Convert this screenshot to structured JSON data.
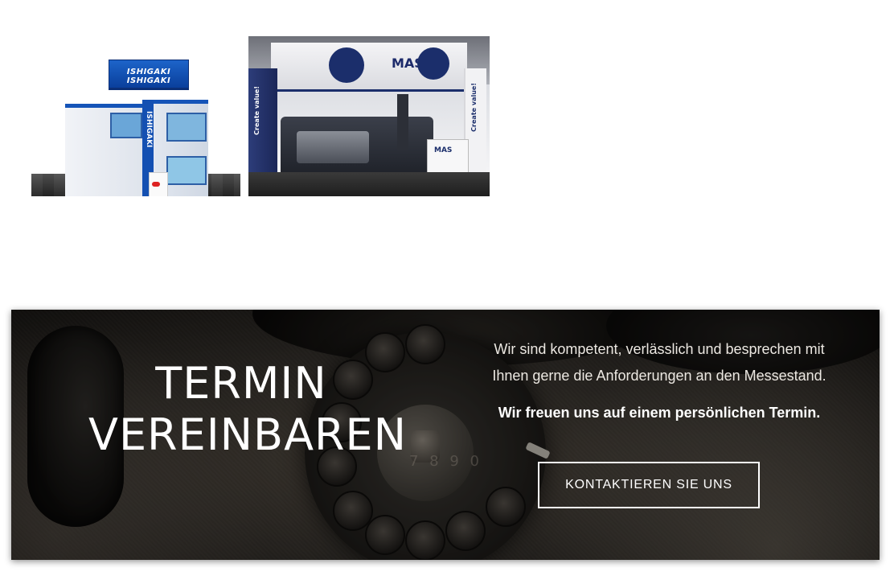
{
  "gallery": {
    "images": [
      {
        "alt": "Messestand ISHIGAKI",
        "sign_text": "ISHIGAKI ISHIGAKI",
        "pillar_text": "ISHIGAKI"
      },
      {
        "alt": "Messestand MAS",
        "brand_text": "MAS",
        "left_panel_text": "Create value!",
        "right_panel_text": "Create value!",
        "counter_text": "MAS"
      }
    ]
  },
  "cta": {
    "title_line1": "TERMIN",
    "title_line2": "VEREINBAREN",
    "text": "Wir sind kompetent, verlässlich und besprechen mit Ihnen gerne die Anforderungen an den Messestand.",
    "emphasis": "Wir freuen uns auf einem persönlichen Termin.",
    "button_label": "KONTAKTIEREN SIE UNS",
    "dial_digits": "7 8 9 0"
  },
  "colors": {
    "brand_blue": "#1554b8",
    "mas_navy": "#1b2e6b",
    "cta_text": "#ffffff"
  }
}
